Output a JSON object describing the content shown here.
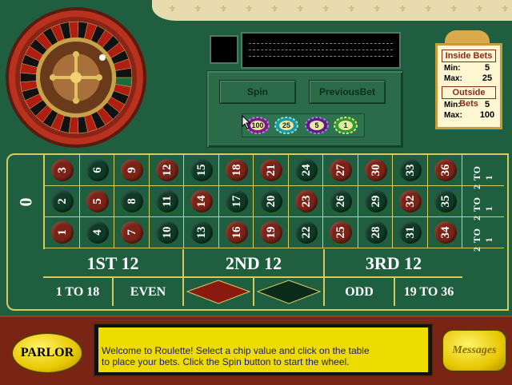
{
  "display": {
    "spin_label": "Spin",
    "previous_bet_label": "PreviousBet"
  },
  "chips": [
    "100",
    "25",
    "5",
    "1"
  ],
  "limits": {
    "inside_title": "Inside Bets",
    "inside_min_label": "Min:",
    "inside_min": "5",
    "inside_max_label": "Max:",
    "inside_max": "25",
    "outside_title": "Outside Bets",
    "outside_min_label": "Min:",
    "outside_min": "5",
    "outside_max_label": "Max:",
    "outside_max": "100"
  },
  "table": {
    "zero": "0",
    "rows": [
      [
        "3",
        "6",
        "9",
        "12",
        "15",
        "18",
        "21",
        "24",
        "27",
        "30",
        "33",
        "36"
      ],
      [
        "2",
        "5",
        "8",
        "11",
        "14",
        "17",
        "20",
        "23",
        "26",
        "29",
        "32",
        "35"
      ],
      [
        "1",
        "4",
        "7",
        "10",
        "13",
        "16",
        "19",
        "22",
        "25",
        "28",
        "31",
        "34"
      ]
    ],
    "column_bet": [
      "2 TO 1",
      "2 TO 1",
      "2 TO 1"
    ],
    "dozens": [
      "1ST 12",
      "2ND 12",
      "3RD 12"
    ],
    "outside": {
      "low": "1 TO 18",
      "even": "EVEN",
      "odd": "ODD",
      "high": "19 TO 36"
    }
  },
  "bottom": {
    "parlor_label": "PARLOR",
    "message_line1": "Welcome to Roulette!  Select a chip value and click on the table",
    "message_line2": "to place your bets.  Click the Spin button to start the wheel.",
    "messages_label": "Messages"
  },
  "colors": {
    "felt": "#1f5f3f",
    "red": "#7a2418",
    "black": "#0f3a26",
    "gold_line": "#d6cb5e"
  }
}
